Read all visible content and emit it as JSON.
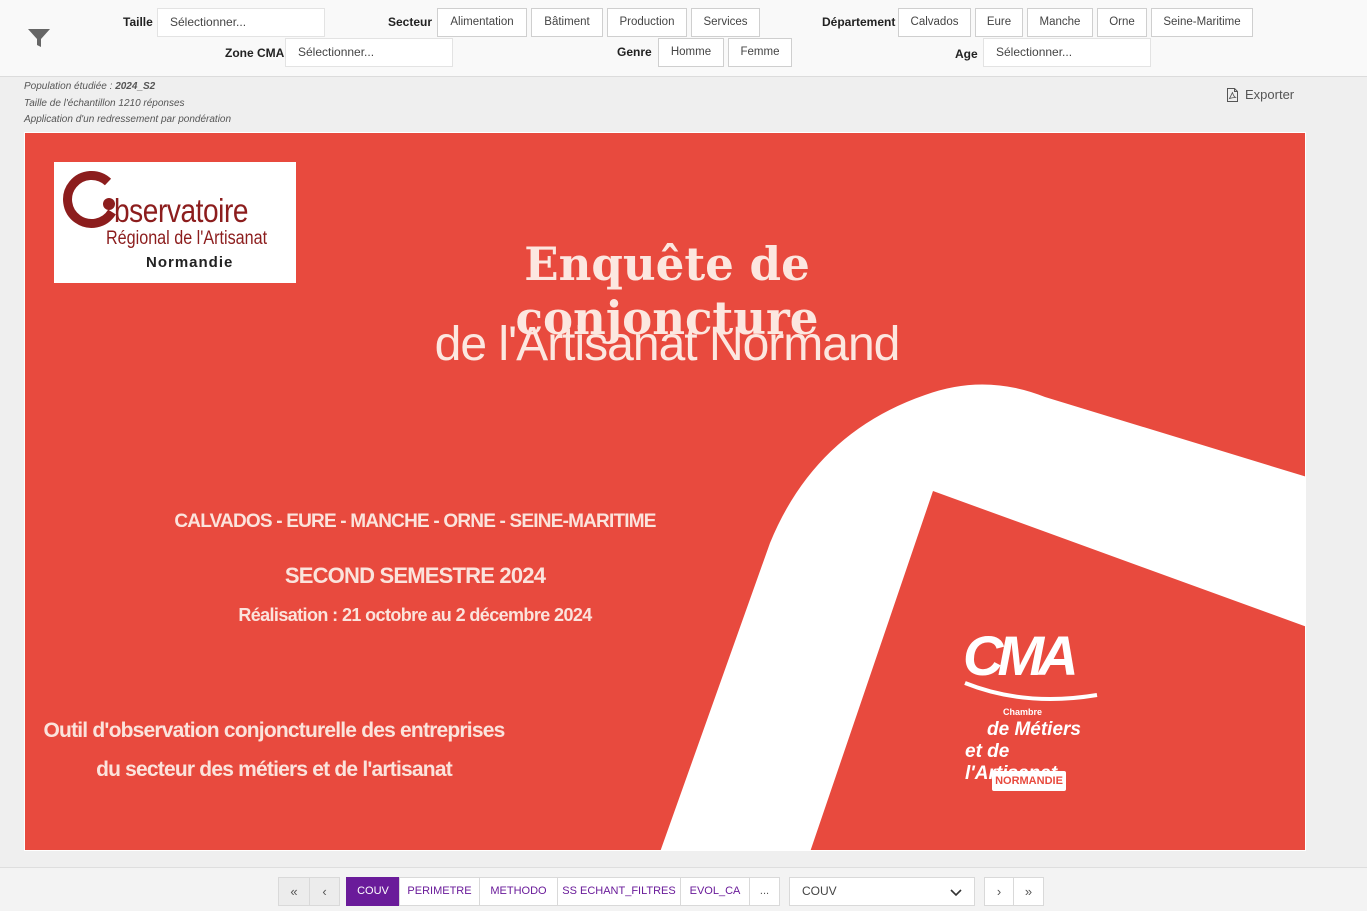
{
  "filters": {
    "taille": {
      "label": "Taille",
      "placeholder": "Sélectionner..."
    },
    "zone_cma": {
      "label": "Zone CMA",
      "placeholder": "Sélectionner..."
    },
    "secteur": {
      "label": "Secteur",
      "options": [
        "Alimentation",
        "Bâtiment",
        "Production",
        "Services"
      ]
    },
    "genre": {
      "label": "Genre",
      "options": [
        "Homme",
        "Femme"
      ]
    },
    "departement": {
      "label": "Département",
      "options": [
        "Calvados",
        "Eure",
        "Manche",
        "Orne",
        "Seine-Maritime"
      ]
    },
    "age": {
      "label": "Age",
      "placeholder": "Sélectionner..."
    }
  },
  "info": {
    "population_prefix": "Population étudiée : ",
    "population_value": "2024_S2",
    "sample": "Taille de l'échantillon 1210 réponses",
    "weighting": "Application d'un redressement par pondération"
  },
  "export_label": "Exporter",
  "slide": {
    "logo": {
      "line1": "bservatoire",
      "line2": "Régional de l'Artisanat",
      "line3": "Normandie"
    },
    "title1": "Enquête de conjoncture",
    "title2": "de l'Artisanat Normand",
    "departements": "CALVADOS - EURE - MANCHE - ORNE - SEINE-MARITIME",
    "semestre": "SECOND SEMESTRE 2024",
    "realisation": "Réalisation : 21 octobre au 2 décembre 2024",
    "outil_line1": "Outil d'observation conjoncturelle des entreprises",
    "outil_line2": "du secteur des métiers et de l'artisanat",
    "cma": {
      "mark": "CMA",
      "chambre": "Chambre",
      "metiers": "de Métiers",
      "artisanat": "et de l'Artisanat",
      "region": "NORMANDIE"
    },
    "colors": {
      "background": "#e84a3e",
      "logo_red": "#8c1d1d"
    }
  },
  "pager": {
    "first": "«",
    "prev": "‹",
    "next": "›",
    "last": "»",
    "tabs": [
      "COUV",
      "PERIMETRE",
      "METHODO",
      "SS ECHANT_FILTRES",
      "EVOL_CA",
      "..."
    ],
    "active_tab": "COUV",
    "select_value": "COUV",
    "accent": "#6a1b9a"
  }
}
